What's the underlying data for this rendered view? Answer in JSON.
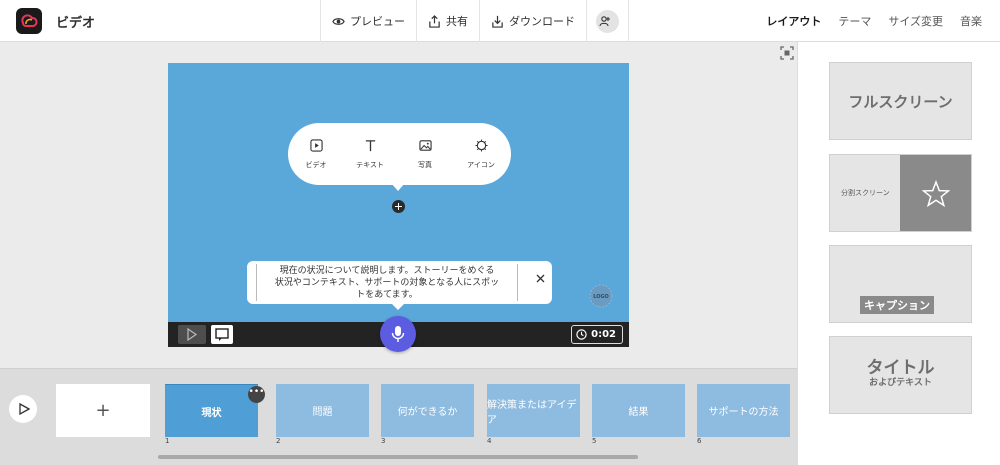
{
  "app": {
    "title": "ビデオ"
  },
  "header": {
    "actions": [
      {
        "label": "プレビュー",
        "icon": "eye-icon"
      },
      {
        "label": "共有",
        "icon": "share-icon"
      },
      {
        "label": "ダウンロード",
        "icon": "download-icon"
      }
    ],
    "add_user_icon": "add-user-icon",
    "tabs": [
      {
        "label": "レイアウト",
        "active": true
      },
      {
        "label": "テーマ"
      },
      {
        "label": "サイズ変更"
      },
      {
        "label": "音楽"
      }
    ]
  },
  "layouts": {
    "fullscreen": "フルスクリーン",
    "split": "分割スクリーン",
    "caption": "キャプション",
    "title_main": "タイトル",
    "title_sub": "およびテキスト"
  },
  "canvas": {
    "background": "#5aa8da",
    "insert_items": [
      {
        "label": "ビデオ",
        "icon": "video-icon"
      },
      {
        "label": "テキスト",
        "icon": "text-icon"
      },
      {
        "label": "写真",
        "icon": "photo-icon"
      },
      {
        "label": "アイコン",
        "icon": "icon-icon"
      }
    ],
    "caption_line1": "現在の状況について説明します。ストーリーをめぐる",
    "caption_line2": "状況やコンテキスト、サポートの対象となる人にスポッ",
    "caption_line3": "トをあてます。",
    "logo_text": "LOGO"
  },
  "playback": {
    "time": "0:02"
  },
  "timeline": {
    "add_label": "+",
    "scenes": [
      {
        "label": "現状",
        "num": "1"
      },
      {
        "label": "問題",
        "num": "2"
      },
      {
        "label": "何ができるか",
        "num": "3"
      },
      {
        "label": "解決策またはアイデア",
        "num": "4"
      },
      {
        "label": "結果",
        "num": "5"
      },
      {
        "label": "サポートの方法",
        "num": "6"
      }
    ],
    "more_label": "•••"
  },
  "colors": {
    "accent": "#5c5ce0",
    "scene_active": "#4f9fd6",
    "scene": "#8ebbe0"
  }
}
